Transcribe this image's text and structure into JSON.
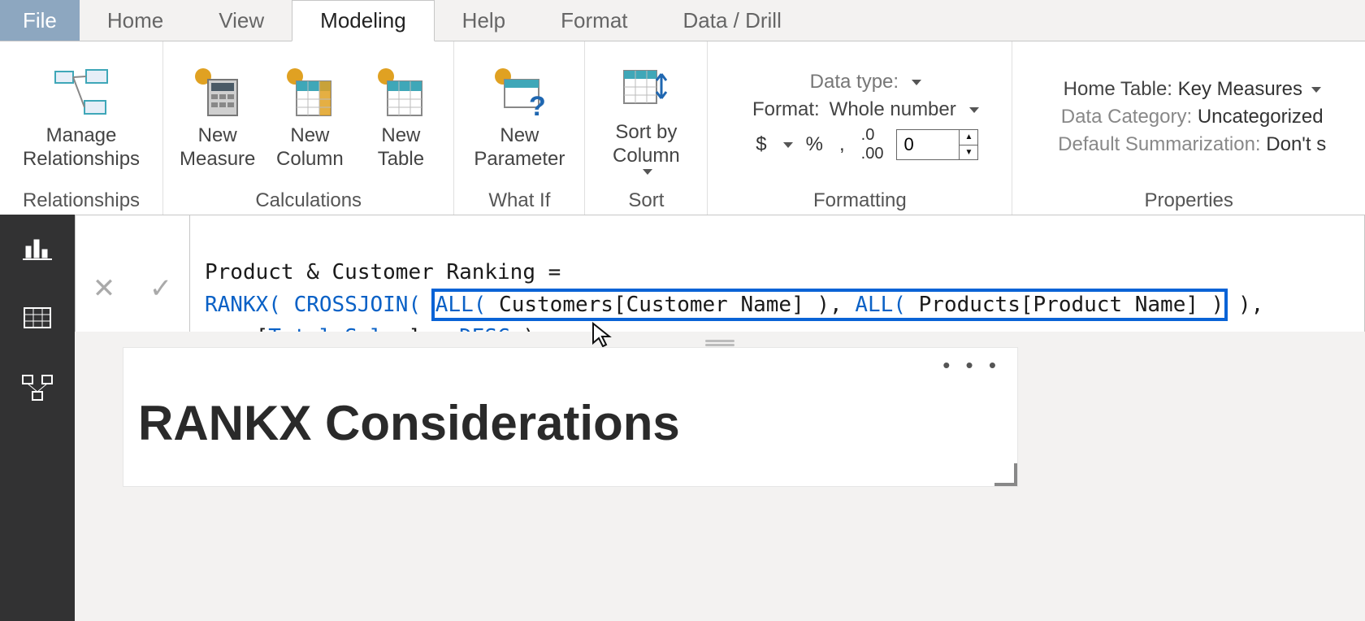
{
  "tabs": {
    "file": "File",
    "home": "Home",
    "view": "View",
    "modeling": "Modeling",
    "help": "Help",
    "format": "Format",
    "data_drill": "Data / Drill"
  },
  "ribbon": {
    "relationships": {
      "manage": "Manage\nRelationships",
      "group": "Relationships"
    },
    "calculations": {
      "new_measure": "New\nMeasure",
      "new_column": "New\nColumn",
      "new_table": "New\nTable",
      "group": "Calculations"
    },
    "whatif": {
      "new_parameter": "New\nParameter",
      "group": "What If"
    },
    "sort": {
      "sort_by_column": "Sort by\nColumn",
      "group": "Sort"
    },
    "formatting": {
      "data_type_label": "Data type:",
      "format_label": "Format:",
      "format_value": "Whole number",
      "decimals_value": "0",
      "group": "Formatting"
    },
    "properties": {
      "home_table_label": "Home Table:",
      "home_table_value": "Key Measures",
      "data_category_label": "Data Category:",
      "data_category_value": "Uncategorized",
      "default_sum_label": "Default Summarization:",
      "default_sum_value": "Don't s",
      "group": "Properties"
    }
  },
  "formula": {
    "line1_name": "Product & Customer Ranking = ",
    "rankx": "RANKX(",
    "crossjoin": "CROSSJOIN(",
    "all1_fn": "ALL(",
    "all1_arg": " Customers[Customer Name] )",
    "comma_sep": ", ",
    "all2_fn": "ALL(",
    "all2_arg": " Products[Product Name] )",
    "close_cross": " ),",
    "line3_pre": "    [",
    "total_sales": "Total Sales",
    "line3_mid": "],, ",
    "desc": "DESC",
    "line3_end": " )"
  },
  "visual": {
    "title": "RANKX Considerations",
    "menu": "• • •"
  },
  "formula_actions": {
    "cancel": "✕",
    "commit": "✓"
  }
}
